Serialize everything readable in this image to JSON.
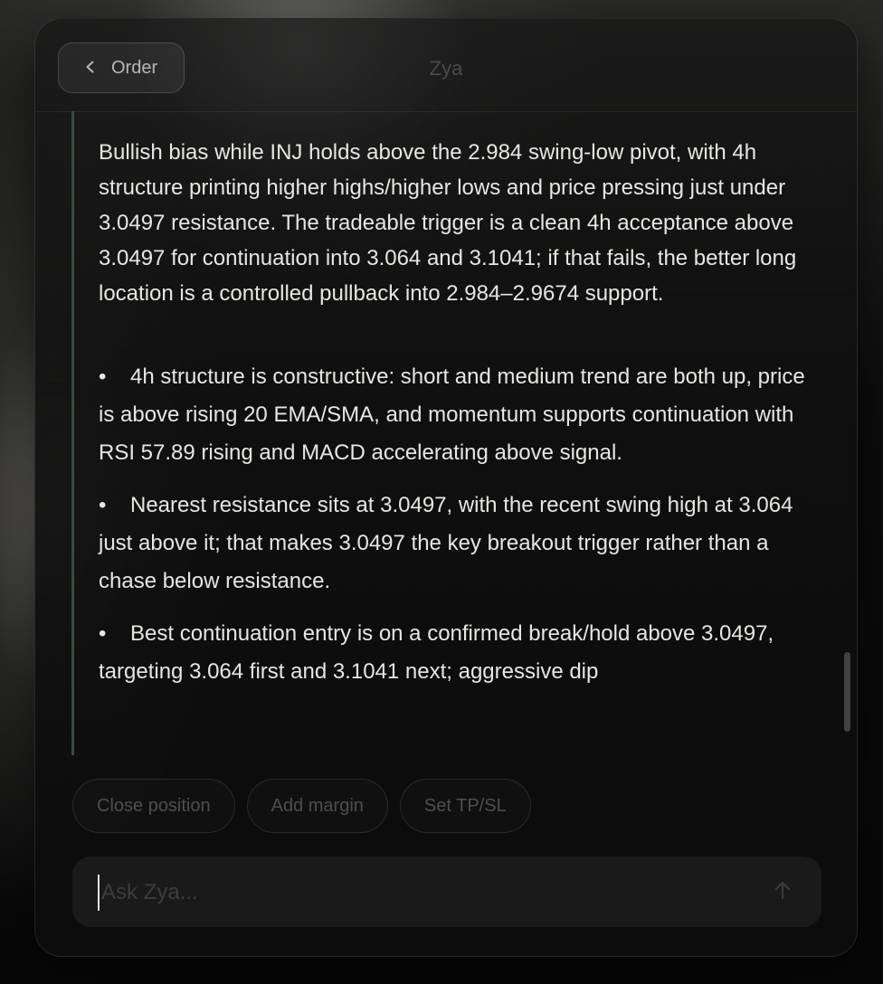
{
  "header": {
    "back_label": "Order",
    "title": "Zya"
  },
  "message": {
    "summary": "Bullish bias while INJ holds above the 2.984 swing-low pivot, with 4h structure printing higher highs/higher lows and price pressing just under 3.0497 resistance. The tradeable trigger is a clean 4h acceptance above 3.0497 for continuation into 3.064 and 3.1041; if that fails, the better long location is a controlled pullback into 2.984–2.9674 support.",
    "bullet_char": "•",
    "bullets": [
      "4h structure is constructive: short and medium trend are both up, price is above rising 20 EMA/SMA, and momentum supports continuation with RSI 57.89 rising and MACD accelerating above signal.",
      "Nearest resistance sits at 3.0497, with the recent swing high at 3.064 just above it; that makes 3.0497 the key breakout trigger rather than a chase below resistance.",
      "Best continuation entry is on a confirmed break/hold above 3.0497, targeting 3.064 first and 3.1041 next; aggressive dip"
    ]
  },
  "actions": {
    "close_position": "Close position",
    "add_margin": "Add margin",
    "set_tp_sl": "Set TP/SL"
  },
  "composer": {
    "placeholder": "Ask Zya...",
    "value": ""
  },
  "icons": {
    "back": "chevron-left-icon",
    "send": "arrow-up-icon"
  },
  "colors": {
    "accent_border": "#3c4a40",
    "text": "#e7e6e2"
  }
}
